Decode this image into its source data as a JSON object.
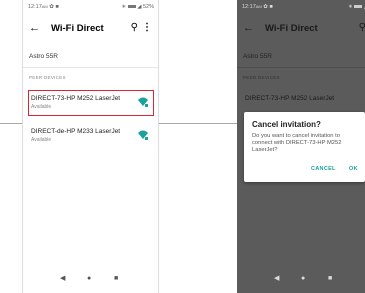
{
  "colors": {
    "accent": "#1aa39a",
    "highlight": "#d7282f",
    "dim_bg": "#5b5b5b"
  },
  "left_screen": {
    "status": {
      "time": "12:17",
      "time_suffix": "AM",
      "right": "52%"
    },
    "appbar": {
      "back_icon": "arrow-back-icon",
      "title": "Wi-Fi Direct",
      "search_icon": "search-icon",
      "more_icon": "more-vert-icon"
    },
    "device_name": "Astro 55R",
    "section_header": "PEER DEVICES",
    "peers": [
      {
        "name": "DIRECT-73-HP M252 LaserJet",
        "status": "Available",
        "icon": "wifi-signal-icon"
      },
      {
        "name": "DIRECT-de-HP M233 LaserJet",
        "status": "Available",
        "icon": "wifi-signal-icon"
      }
    ]
  },
  "right_screen": {
    "status": {
      "time": "12:17",
      "time_suffix": "AM"
    },
    "appbar": {
      "back_icon": "arrow-back-icon",
      "title": "Wi-Fi Direct",
      "search_icon": "search-icon"
    },
    "device_name": "Astro 55R",
    "section_header": "PEER DEVICES",
    "peer_name": "DIRECT-73-HP M252 LaserJet",
    "dialog": {
      "title": "Cancel invitation?",
      "message": "Do you want to cancel invitation to connect with DIRECT-73-HP M252 LaserJet?",
      "cancel_label": "CANCEL",
      "ok_label": "OK"
    }
  },
  "navbar": {
    "back_icon": "nav-back-icon",
    "home_icon": "nav-home-icon",
    "recents_icon": "nav-recents-icon"
  }
}
